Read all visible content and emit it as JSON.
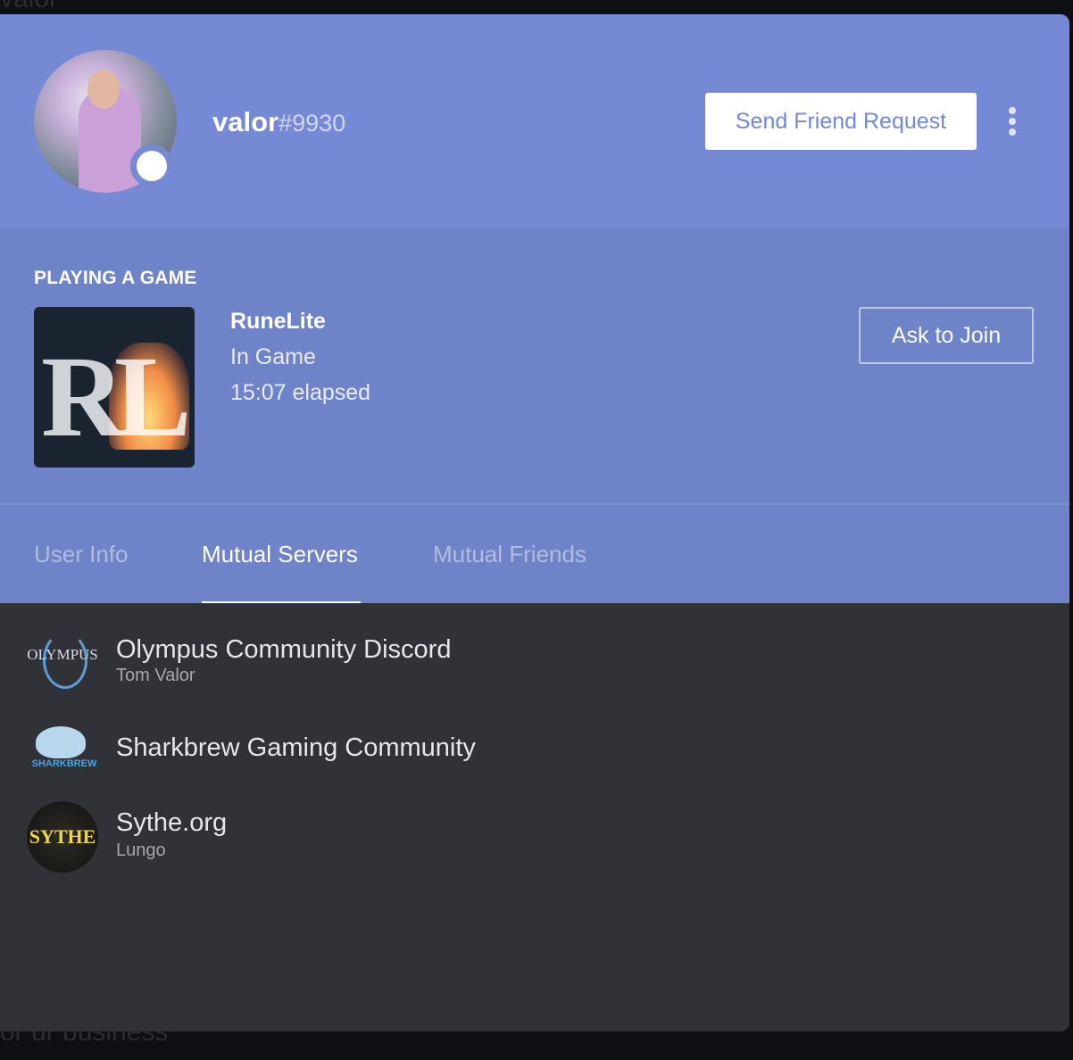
{
  "background": {
    "top_text": "valor",
    "bottom_text": "or ur business"
  },
  "profile": {
    "username": "valor",
    "discriminator": "#9930",
    "status": "online",
    "send_friend_request_label": "Send Friend Request"
  },
  "activity": {
    "header": "PLAYING A GAME",
    "game_icon_text": "RL",
    "game_name": "RuneLite",
    "state": "In Game",
    "elapsed": "15:07 elapsed",
    "join_label": "Ask to Join"
  },
  "tabs": [
    {
      "label": "User Info",
      "active": false
    },
    {
      "label": "Mutual Servers",
      "active": true
    },
    {
      "label": "Mutual Friends",
      "active": false
    }
  ],
  "servers": [
    {
      "name": "Olympus Community Discord",
      "nickname": "Tom Valor",
      "icon_text": "OLYMPUS"
    },
    {
      "name": "Sharkbrew Gaming Community",
      "nickname": "",
      "icon_text": "SHARKBREW"
    },
    {
      "name": "Sythe.org",
      "nickname": "Lungo",
      "icon_text": "SYTHE"
    }
  ],
  "colors": {
    "header_bg": "#7589d5",
    "activity_bg": "#6f83c8",
    "list_bg": "#303237",
    "accent": "#7289da"
  }
}
